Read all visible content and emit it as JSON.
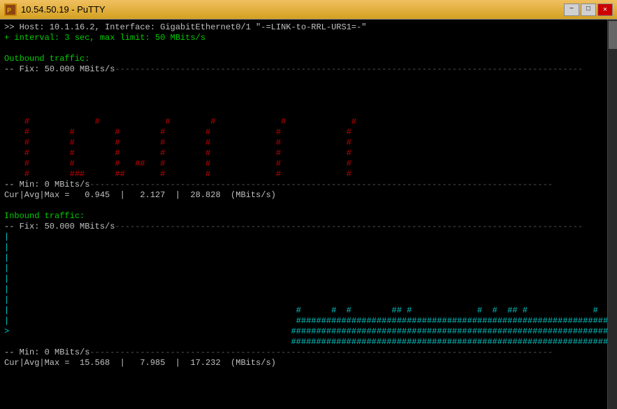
{
  "window": {
    "title": "10.54.50.19 - PuTTY",
    "minimize_label": "−",
    "maximize_label": "□",
    "close_label": "✕"
  },
  "terminal": {
    "line1": ">> Host: 10.1.16.2, Interface: GigabitEthernet0/1 \"-=LINK-to-RRL-URS1=-\"",
    "line2": "+ interval: 3 sec, max limit: 50 MBits/s",
    "line3": "",
    "outbound_label": "Outbound traffic:",
    "outbound_fix": "-- Fix: 50.000 MBits/s",
    "outbound_min": "-- Min: 0 MBits/s",
    "outbound_stats": "Cur|Avg|Max =   0.945  |   2.127  |  28.828  (MBits/s)",
    "inbound_label": "Inbound traffic:",
    "inbound_fix": "-- Fix: 50.000 MBits/s",
    "inbound_min": "-- Min: 0 MBits/s",
    "inbound_stats": "Cur|Avg|Max =  15.568  |   7.985  |  17.232  (MBits/s)"
  }
}
